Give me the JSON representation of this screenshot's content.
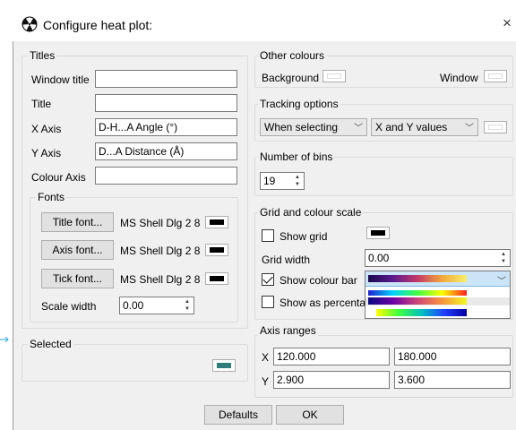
{
  "window": {
    "title": "Configure heat plot:",
    "close_glyph": "×"
  },
  "titles": {
    "group_label": "Titles",
    "window_title_label": "Window title",
    "window_title_value": "",
    "title_label": "Title",
    "title_value": "",
    "x_axis_label": "X Axis",
    "x_axis_value": "D-H...A Angle (°)",
    "y_axis_label": "Y Axis",
    "y_axis_value": "D...A Distance (Å)",
    "colour_axis_label": "Colour Axis",
    "colour_axis_value": ""
  },
  "fonts": {
    "group_label": "Fonts",
    "title_font_button": "Title font...",
    "title_font_value": "MS Shell Dlg 2 8",
    "axis_font_button": "Axis font...",
    "axis_font_value": "MS Shell Dlg 2 8",
    "tick_font_button": "Tick font...",
    "tick_font_value": "MS Shell Dlg 2 8",
    "scale_width_label": "Scale width",
    "scale_width_value": "0.00"
  },
  "selected": {
    "group_label": "Selected",
    "swatch_color": "#2e7d7a"
  },
  "other_colours": {
    "group_label": "Other colours",
    "background_label": "Background",
    "window_label": "Window"
  },
  "tracking": {
    "group_label": "Tracking options",
    "mode_value": "When selecting",
    "values_value": "X and Y values"
  },
  "bins": {
    "group_label": "Number of bins",
    "value": "19"
  },
  "grid": {
    "group_label": "Grid and colour scale",
    "show_grid_label": "Show grid",
    "show_grid_checked": false,
    "grid_width_label": "Grid width",
    "grid_width_value": "0.00",
    "show_colour_bar_label": "Show colour bar",
    "show_colour_bar_checked": true,
    "show_percentage_label": "Show as percentag",
    "show_percentage_checked": false,
    "colour_scale_options": [
      "viridis-like",
      "jet",
      "plasma-like",
      "rainbow"
    ]
  },
  "axis_ranges": {
    "group_label": "Axis ranges",
    "x_label": "X",
    "x_min": "120.000",
    "x_max": "180.000",
    "y_label": "Y",
    "y_min": "2.900",
    "y_max": "3.600"
  },
  "buttons": {
    "defaults": "Defaults",
    "ok": "OK"
  },
  "colors": {
    "font_swatch": "#000000",
    "dialog_bg": "#f0f0f0"
  }
}
